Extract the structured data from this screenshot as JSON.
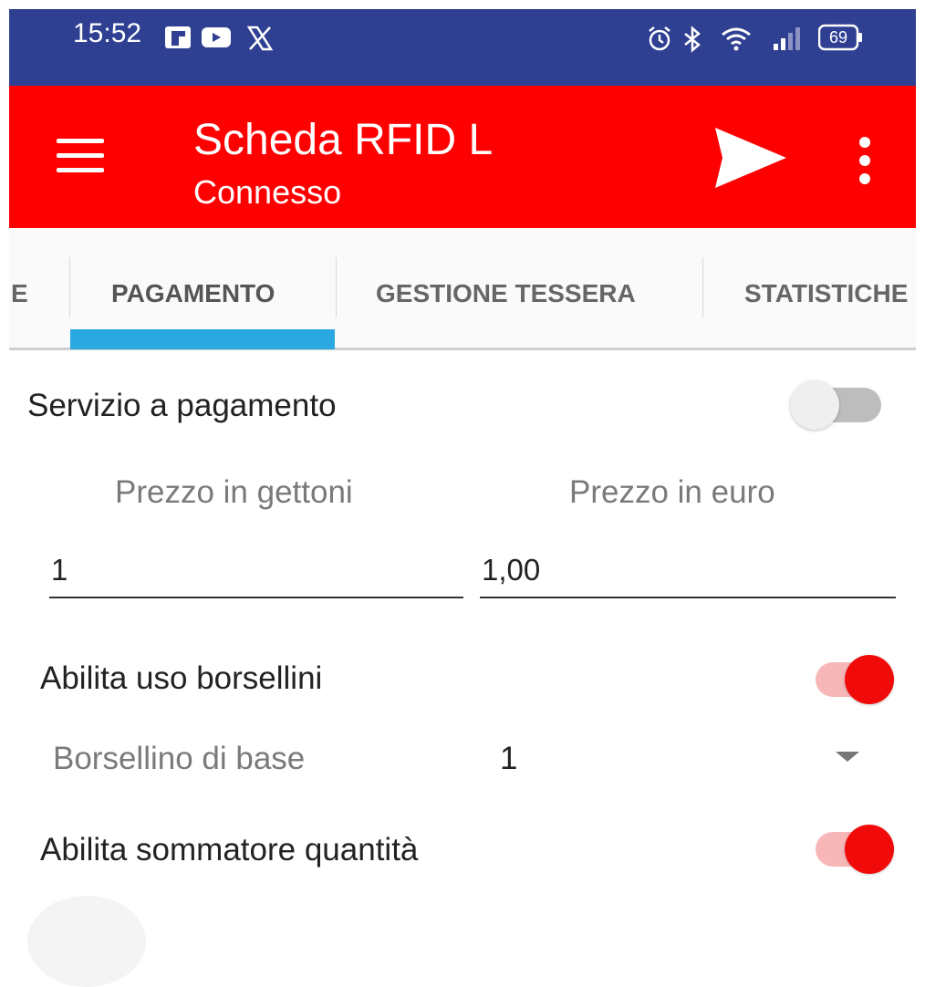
{
  "status_bar": {
    "time": "15:52",
    "battery": "69",
    "bg_color": "#2f3f92",
    "left_icons": [
      "flipboard-icon",
      "youtube-icon",
      "x-icon"
    ],
    "right_icons": [
      "alarm-icon",
      "bluetooth-icon",
      "wifi-icon",
      "signal-icon",
      "battery-icon"
    ]
  },
  "app_bar": {
    "title": "Scheda RFID L",
    "subtitle": "Connesso",
    "bg_color": "#ff0000",
    "menu_icon": "hamburger-icon",
    "send_icon": "send-icon",
    "more_icon": "more-vert-icon"
  },
  "tabs": {
    "items": [
      {
        "label": "E",
        "active": false
      },
      {
        "label": "PAGAMENTO",
        "active": true
      },
      {
        "label": "GESTIONE TESSERA",
        "active": false
      },
      {
        "label": "STATISTICHE",
        "active": false
      }
    ],
    "indicator_color": "#2aa8e0"
  },
  "content": {
    "paid_service": {
      "label": "Servizio a pagamento",
      "enabled": false
    },
    "price_tokens": {
      "label": "Prezzo in gettoni",
      "value": "1"
    },
    "price_euro": {
      "label": "Prezzo in euro",
      "value": "1,00"
    },
    "enable_wallets": {
      "label": "Abilita uso borsellini",
      "enabled": true
    },
    "base_wallet": {
      "label": "Borsellino di base",
      "value": "1"
    },
    "enable_quantity_sum": {
      "label": "Abilita sommatore quantità",
      "enabled": true
    }
  }
}
